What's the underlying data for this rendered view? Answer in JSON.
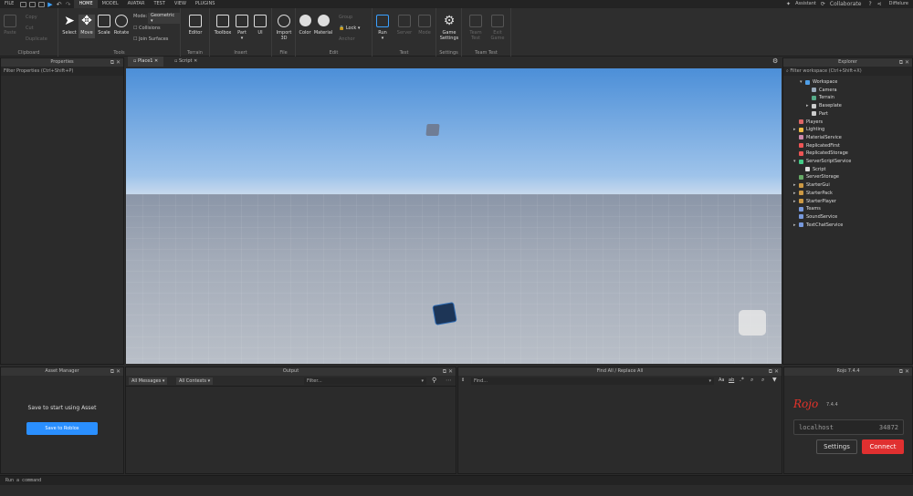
{
  "topbar": {
    "file": "FILE",
    "tabs": [
      {
        "label": "HOME"
      },
      {
        "label": "MODEL"
      },
      {
        "label": "AVATAR"
      },
      {
        "label": "TEST"
      },
      {
        "label": "VIEW"
      },
      {
        "label": "PLUGINS"
      }
    ],
    "assistant": "Assistant",
    "collaborate": "Collaborate",
    "user": "Diffelure"
  },
  "ribbon": {
    "clipboard": {
      "paste": "Paste",
      "copy": "Copy",
      "cut": "Cut",
      "duplicate": "Duplicate",
      "label": "Clipboard"
    },
    "tools": {
      "select": "Select",
      "move": "Move",
      "scale": "Scale",
      "rotate": "Rotate",
      "mode_label": "Mode:",
      "mode_value": "Geometric",
      "collisions": "Collisions",
      "join": "Join Surfaces",
      "label": "Tools"
    },
    "terrain": {
      "editor": "Editor",
      "label": "Terrain"
    },
    "insert": {
      "toolbox": "Toolbox",
      "part": "Part",
      "ui": "UI",
      "label": "Insert"
    },
    "file": {
      "import": "Import 3D",
      "label": "File"
    },
    "edit": {
      "color": "Color",
      "material": "Material",
      "group": "Group",
      "lock": "Lock",
      "anchor": "Anchor",
      "label": "Edit"
    },
    "test": {
      "run": "Run",
      "server": "Server",
      "mode": "Mode",
      "label": "Test"
    },
    "settings": {
      "game_settings": "Game Settings",
      "label": "Settings"
    },
    "team_test": {
      "team": "Team Test",
      "exit": "Exit Game",
      "label": "Team Test"
    }
  },
  "properties": {
    "title": "Properties",
    "filter": "Filter Properties (Ctrl+Shift+P)"
  },
  "tabs": [
    {
      "label": "Place1"
    },
    {
      "label": "Script"
    }
  ],
  "explorer": {
    "title": "Explorer",
    "filter": "Filter workspace (Ctrl+Shift+X)",
    "items": [
      {
        "label": "Workspace",
        "color": "#4f9fe8"
      },
      {
        "label": "Camera",
        "color": "#9ab"
      },
      {
        "label": "Terrain",
        "color": "#5a8"
      },
      {
        "label": "Baseplate",
        "color": "#ccc"
      },
      {
        "label": "Part",
        "color": "#ccc"
      },
      {
        "label": "Players",
        "color": "#d66"
      },
      {
        "label": "Lighting",
        "color": "#eb4"
      },
      {
        "label": "MaterialService",
        "color": "#c8a"
      },
      {
        "label": "ReplicatedFirst",
        "color": "#e55"
      },
      {
        "label": "ReplicatedStorage",
        "color": "#e55"
      },
      {
        "label": "ServerScriptService",
        "color": "#4c8"
      },
      {
        "label": "Script",
        "color": "#ddd"
      },
      {
        "label": "ServerStorage",
        "color": "#6a6"
      },
      {
        "label": "StarterGui",
        "color": "#c94"
      },
      {
        "label": "StarterPack",
        "color": "#c94"
      },
      {
        "label": "StarterPlayer",
        "color": "#c94"
      },
      {
        "label": "Teams",
        "color": "#79d"
      },
      {
        "label": "SoundService",
        "color": "#79d"
      },
      {
        "label": "TextChatService",
        "color": "#79d"
      }
    ]
  },
  "asset_manager": {
    "title": "Asset Manager",
    "message": "Save to start using Asset",
    "button": "Save to Roblox"
  },
  "output": {
    "title": "Output",
    "messages": "All Messages",
    "contexts": "All Contexts",
    "filter": "Filter..."
  },
  "find": {
    "title": "Find All / Replace All",
    "placeholder": "Find...",
    "aa": "Aa",
    "ab": "ab"
  },
  "rojo": {
    "title": "Rojo 7.4.4",
    "logo": "Rojo",
    "version": "7.4.4",
    "host": "localhost",
    "port": "34872",
    "settings": "Settings",
    "connect": "Connect"
  },
  "command": {
    "placeholder": "Run a command"
  }
}
